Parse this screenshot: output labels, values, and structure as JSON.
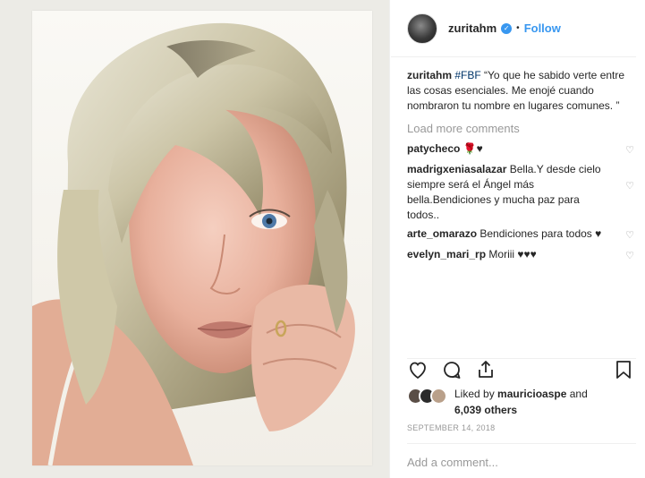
{
  "post": {
    "username": "zuritahm",
    "follow_label": "Follow",
    "dot": "•"
  },
  "caption": {
    "username": "zuritahm",
    "tag": "#FBF",
    "text": " “Yo que he sabido verte entre las cosas esenciales. Me enojé cuando nombraron tu nombre en lugares comunes. ”"
  },
  "load_more": "Load more comments",
  "comments": [
    {
      "username": "patycheco",
      "text": " 🌹♥"
    },
    {
      "username": "madrigxeniasalazar",
      "text": " Bella.Y desde cielo siempre será el Ángel más bella.Bendiciones y mucha paz para todos.."
    },
    {
      "username": "arte_omarazo",
      "text": " Bendiciones para todos ♥"
    },
    {
      "username": "evelyn_mari_rp",
      "text": " Moriii ♥♥♥"
    }
  ],
  "likes": {
    "prefix": "Liked by ",
    "user": "mauricioaspe",
    "and": " and",
    "count": "6,039 others"
  },
  "date": "SEPTEMBER 14, 2018",
  "add_comment_placeholder": "Add a comment...",
  "icons": {
    "heart": "heart-icon",
    "comment": "comment-icon",
    "share": "share-icon",
    "save": "bookmark-icon"
  },
  "colors": {
    "accent": "#3897f0",
    "muted": "#999999",
    "text": "#262626"
  }
}
